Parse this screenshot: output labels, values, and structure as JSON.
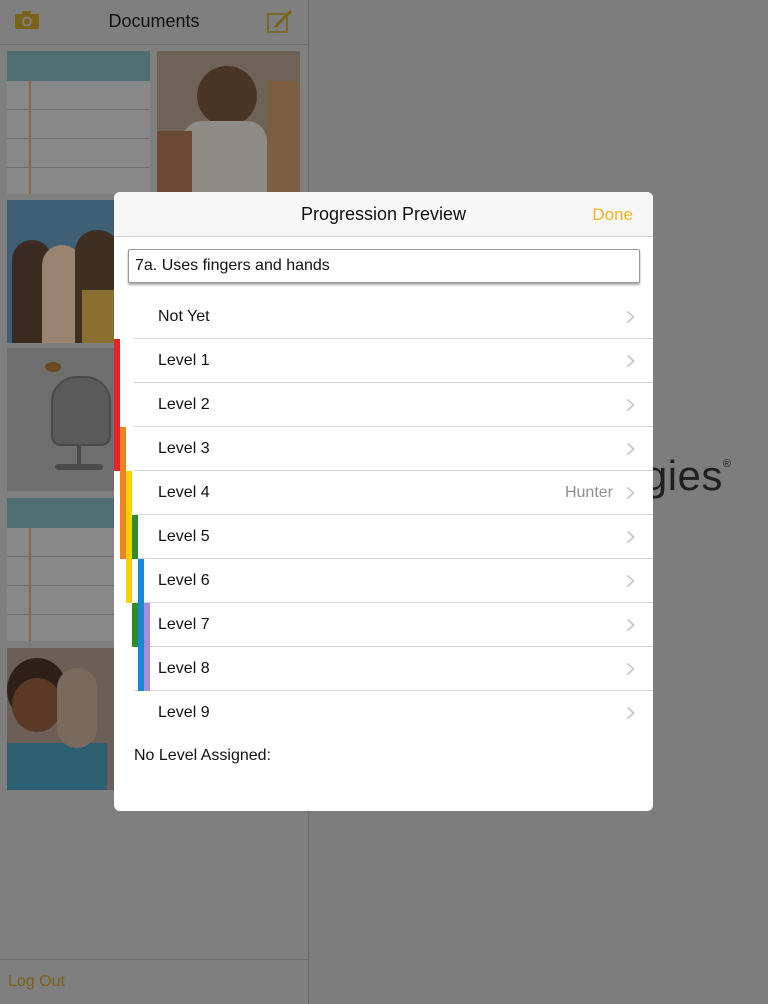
{
  "sidebar": {
    "title": "Documents",
    "logout_label": "Log Out"
  },
  "background_logo": {
    "text": "egies",
    "mark": "®"
  },
  "modal": {
    "title": "Progression Preview",
    "done_label": "Done",
    "objective": "7a. Uses fingers and hands",
    "rows": [
      {
        "label": "Not Yet",
        "detail": ""
      },
      {
        "label": "Level 1",
        "detail": ""
      },
      {
        "label": "Level 2",
        "detail": ""
      },
      {
        "label": "Level 3",
        "detail": ""
      },
      {
        "label": "Level 4",
        "detail": "Hunter"
      },
      {
        "label": "Level 5",
        "detail": ""
      },
      {
        "label": "Level 6",
        "detail": ""
      },
      {
        "label": "Level 7",
        "detail": ""
      },
      {
        "label": "Level 8",
        "detail": ""
      },
      {
        "label": "Level 9",
        "detail": ""
      }
    ],
    "no_level_label": "No Level Assigned:"
  },
  "colors": {
    "accent": "#f0b323",
    "red": "#e8222a",
    "orange": "#f2821f",
    "yellow": "#f7d200",
    "green": "#2e8b2e",
    "blue": "#1b86d6",
    "purple": "#a98bd8"
  }
}
